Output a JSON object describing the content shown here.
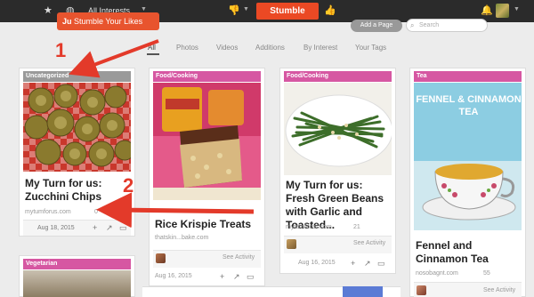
{
  "topbar": {
    "interests_label": "All Interests",
    "stumble_label": "Stumble"
  },
  "subheader": {
    "likes_label": "Stumble Your Likes",
    "add_page_label": "Add a Page",
    "search_placeholder": "Search"
  },
  "filters": [
    "All",
    "Photos",
    "Videos",
    "Additions",
    "By Interest",
    "Your Tags"
  ],
  "cards": [
    {
      "category": "Uncategorized",
      "title": "My Turn for us: Zucchini Chips",
      "source": "mytumforus.com",
      "count": "0",
      "date": "Aug 18, 2015",
      "see_activity": ""
    },
    {
      "category": "Food/Cooking",
      "title": "Rice Krispie Treats",
      "source": "thatskin...bake.com",
      "count": "",
      "date": "Aug 16, 2015",
      "see_activity": "See Activity"
    },
    {
      "category": "Food/Cooking",
      "title": "My Turn for us: Fresh Green Beans with Garlic and Toasted...",
      "source": "mytumforus.com",
      "count": "21",
      "date": "Aug 16, 2015",
      "see_activity": "See Activity"
    },
    {
      "category": "Tea",
      "title": "Fennel and Cinnamon Tea",
      "source": "nosobagnt.com",
      "count": "55",
      "date": "",
      "see_activity": "See Activity",
      "image_text": "FENNEL & CINNAMON TEA"
    },
    {
      "category": "Vegetarian",
      "title": "",
      "source": "",
      "count": "",
      "date": "",
      "see_activity": ""
    }
  ],
  "annotations": [
    "1",
    "2"
  ],
  "colors": {
    "accent": "#eb4924",
    "category_pink": "#d657a2",
    "category_gray": "#9a9a9a",
    "annotation_red": "#e33a2a"
  }
}
